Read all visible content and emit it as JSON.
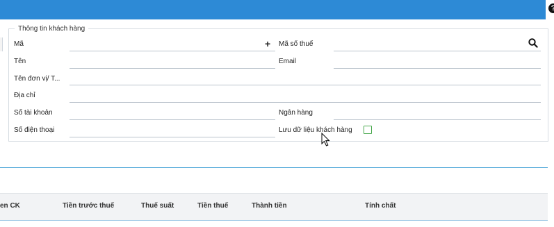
{
  "header": {
    "help_icon": "?"
  },
  "customer_info": {
    "legend": "Thông tin khách hàng",
    "fields": {
      "ma": {
        "label": "Mã",
        "value": ""
      },
      "ma_so_thue": {
        "label": "Mã số thuế",
        "value": ""
      },
      "ten": {
        "label": "Tên",
        "value": ""
      },
      "email": {
        "label": "Email",
        "value": ""
      },
      "ten_don_vi": {
        "label": "Tên đơn vị/ T...",
        "value": ""
      },
      "dia_chi": {
        "label": "Địa chỉ",
        "value": ""
      },
      "so_tai_khoan": {
        "label": "Số tài khoản",
        "value": ""
      },
      "ngan_hang": {
        "label": "Ngân hàng",
        "value": ""
      },
      "so_dien_thoai": {
        "label": "Số điện thoại",
        "value": ""
      }
    },
    "save_customer_label": "Lưu dữ liệu khách hàng",
    "save_customer_checked": false,
    "icons": {
      "add": "plus-icon",
      "search": "search-icon",
      "help": "help-icon"
    },
    "colors": {
      "header_bar": "#2d8ad6",
      "checkbox_border": "#4aa94e",
      "separator": "#46a2d6"
    }
  },
  "table": {
    "columns": [
      "en CK",
      "Tiền trước thuế",
      "Thuế suất",
      "Tiền thuế",
      "Thành tiền",
      "Tính chất"
    ]
  }
}
